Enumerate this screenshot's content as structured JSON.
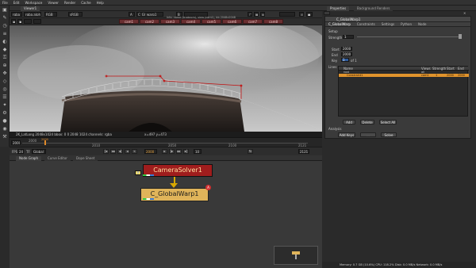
{
  "menubar": [
    "File",
    "Edit",
    "Workspace",
    "Viewer",
    "Render",
    "Cache",
    "Help"
  ],
  "viewer": {
    "tab": "Viewer1",
    "channels": "rgba",
    "alpha": "rgba.alpha",
    "colorspace": "RGB",
    "gamma": "sRGB",
    "input_a": "A",
    "input_b": "B",
    "node_a": "C_Gl_warp1",
    "info_top": "Info: name (snakecm), view (cam1), bb 2048x2048",
    "cams": [
      "cam1",
      "cam2",
      "cam3",
      "cam4",
      "cam5",
      "cam6",
      "cam7",
      "cam8"
    ],
    "frame_label": "F",
    "info_line": "2K_LatLong 2048x1024  bbox: 0 0 2048 1024 channels: rgba",
    "coords": "x=497 y=473"
  },
  "timeline": {
    "ticks": [
      "2000",
      "2010",
      "2050",
      "2100",
      "2121"
    ],
    "playhead_label": "2000",
    "in": "2000",
    "fps_label": "FPS",
    "fps": "24",
    "tf_label": "TF",
    "tf_value": "Global",
    "frame": "2000",
    "step": "10",
    "range_end": "2121"
  },
  "panels": {
    "tabs": [
      "Node Graph",
      "Curve Editor",
      "Dope Sheet"
    ]
  },
  "nodes": {
    "solver": "CameraSolver1",
    "warp": "C_GlobalWarp1",
    "warp_badge": "A"
  },
  "properties": {
    "tab": "Properties",
    "tab2": "Background Renders",
    "node_name": "C_GlobalWarp1",
    "subtabs": [
      "C_GlobalWarp",
      "Constraints",
      "Settings",
      "Python",
      "Node"
    ],
    "setup_label": "Setup",
    "strength_label": "Strength",
    "strength_value": "1",
    "start_label": "Start",
    "start_value": "2000",
    "end_label": "End",
    "end_value": "2000",
    "key_label": "Key",
    "key_value": "1",
    "key_of": "of 1",
    "lines_label": "Lines",
    "cols": [
      "Name",
      "Views",
      "Strength",
      "Start",
      "End"
    ],
    "row1": {
      "name": "root",
      "views": "all",
      "strength": "",
      "start": "",
      "end": ""
    },
    "row2": {
      "name": "Constraint1",
      "views": "cam1",
      "strength": "1",
      "start": "2000",
      "end": "2000"
    },
    "add_button": "Add",
    "delete_button": "Delete",
    "select_all_button": "Select All",
    "analysis_label": "Analysis",
    "add_keys_button": "Add Keys",
    "dim_button": "...",
    "solve_button": "Solve"
  },
  "status": "Memory: 0.7 GB (10.6%)  CPU: 118.2%  Disk: 0.0 MB/s  Network: 0.0 MB/s"
}
